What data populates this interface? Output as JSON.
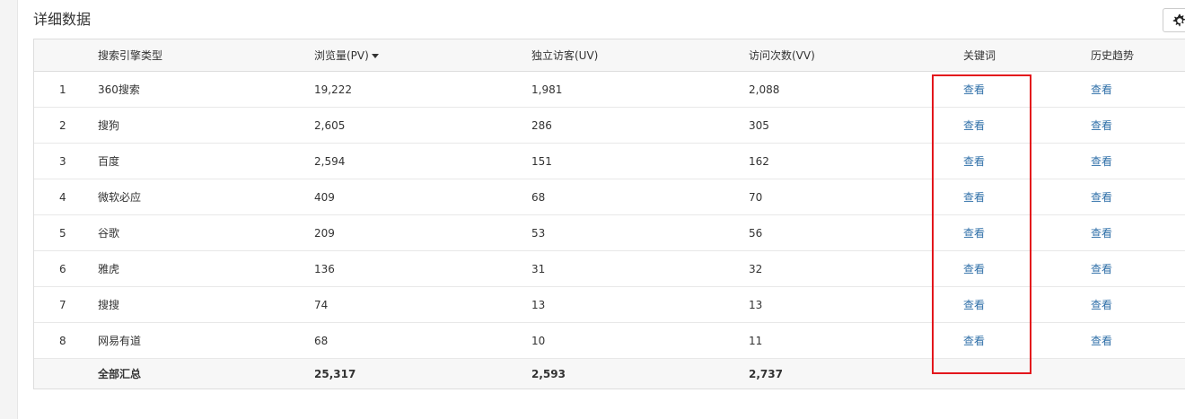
{
  "section_title": "详细数据",
  "settings_icon": "gear-icon",
  "table": {
    "headers": {
      "index": "",
      "engine_type": "搜索引擎类型",
      "pv": "浏览量(PV)",
      "uv": "独立访客(UV)",
      "vv": "访问次数(VV)",
      "keywords": "关键词",
      "history": "历史趋势"
    },
    "rows": [
      {
        "index": "1",
        "engine": "360搜索",
        "pv": "19,222",
        "uv": "1,981",
        "vv": "2,088",
        "keywords": "查看",
        "history": "查看"
      },
      {
        "index": "2",
        "engine": "搜狗",
        "pv": "2,605",
        "uv": "286",
        "vv": "305",
        "keywords": "查看",
        "history": "查看"
      },
      {
        "index": "3",
        "engine": "百度",
        "pv": "2,594",
        "uv": "151",
        "vv": "162",
        "keywords": "查看",
        "history": "查看"
      },
      {
        "index": "4",
        "engine": "微软必应",
        "pv": "409",
        "uv": "68",
        "vv": "70",
        "keywords": "查看",
        "history": "查看"
      },
      {
        "index": "5",
        "engine": "谷歌",
        "pv": "209",
        "uv": "53",
        "vv": "56",
        "keywords": "查看",
        "history": "查看"
      },
      {
        "index": "6",
        "engine": "雅虎",
        "pv": "136",
        "uv": "31",
        "vv": "32",
        "keywords": "查看",
        "history": "查看"
      },
      {
        "index": "7",
        "engine": "搜搜",
        "pv": "74",
        "uv": "13",
        "vv": "13",
        "keywords": "查看",
        "history": "查看"
      },
      {
        "index": "8",
        "engine": "网易有道",
        "pv": "68",
        "uv": "10",
        "vv": "11",
        "keywords": "查看",
        "history": "查看"
      }
    ],
    "total": {
      "label": "全部汇总",
      "pv": "25,317",
      "uv": "2,593",
      "vv": "2,737"
    }
  },
  "colors": {
    "link": "#2f6fa8",
    "highlight": "#e3161c",
    "header_bg": "#f7f7f7"
  }
}
